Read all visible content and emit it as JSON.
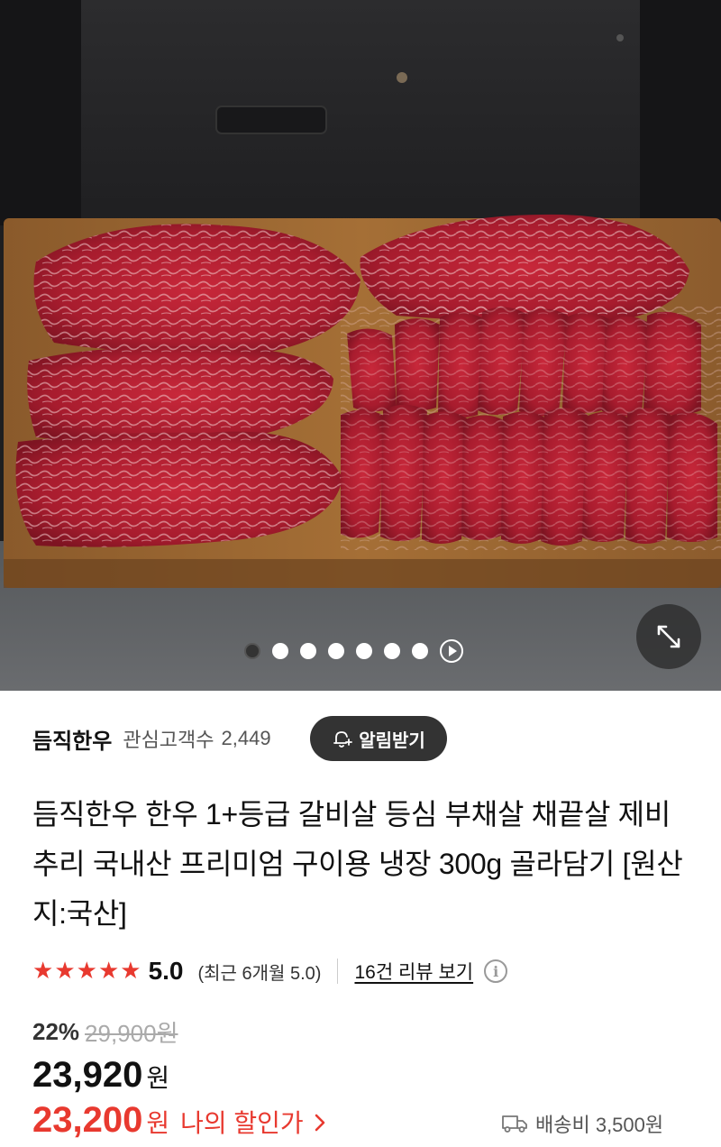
{
  "hero": {
    "image_alt": "",
    "carousel": {
      "count": 7,
      "active_index": 0,
      "has_video": true
    }
  },
  "store": {
    "name": "듬직한우",
    "fan_label": "관심고객수",
    "fan_count": "2,449",
    "alarm_label": "알림받기"
  },
  "product": {
    "title": "듬직한우 한우 1+등급 갈비살 등심 부채살 채끝살 제비추리 국내산 프리미엄 구이용 냉장 300g 골라담기 [원산지:국산]"
  },
  "rating": {
    "stars": 5,
    "score": "5.0",
    "recent": "(최근 6개월 5.0)",
    "review_link": "16건 리뷰 보기"
  },
  "price": {
    "discount_rate": "22%",
    "original": "29,900원",
    "sale": "23,920",
    "sale_unit": "원",
    "my_price": "23,200",
    "my_unit": "원",
    "my_label": "나의 할인가",
    "shipping": "배송비 3,500원"
  },
  "colors": {
    "accent": "#e8392f",
    "button_bg": "#333333"
  },
  "icons": [
    "expand-icon",
    "bell-plus-icon",
    "star-icon",
    "info-icon",
    "chevron-right-icon",
    "truck-icon",
    "play-icon"
  ]
}
